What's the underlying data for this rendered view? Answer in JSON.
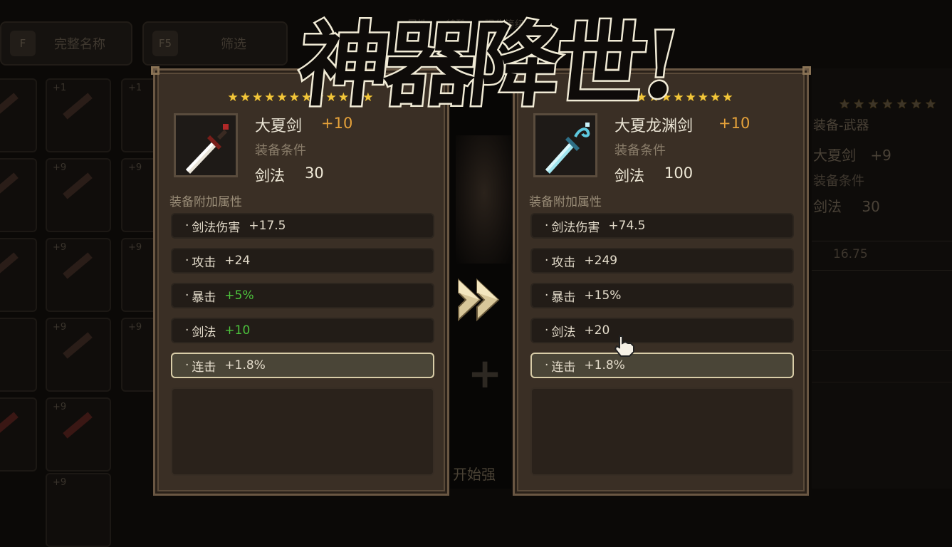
{
  "title_banner": "神器降世!",
  "background": {
    "buttons": [
      {
        "key": "F",
        "label": "完整名称"
      },
      {
        "key": "F5",
        "label": "筛选"
      }
    ],
    "tabs": [
      "属性",
      "特殊",
      "强化等级"
    ],
    "grid_levels": [
      "+1",
      "+1",
      "+9",
      "+9",
      "+9",
      "+9",
      "+9",
      "+9",
      "+9",
      "+9"
    ],
    "side_panel": {
      "stars": "★★★★★★★",
      "category": "装备-武器",
      "item": "大夏剑",
      "item_plus": "+9",
      "req_label": "装备条件",
      "skill": "剑法",
      "skill_value": "30",
      "stat_value": "16.75"
    },
    "start_text": "开始强"
  },
  "left_panel": {
    "stars": "★★★★★★★★★★★★",
    "icon": "sword-icon",
    "name": "大夏剑",
    "plus": "+10",
    "req_label": "装备条件",
    "skill_label": "剑法",
    "skill_value": "30",
    "attr_title": "装备附加属性",
    "attrs": [
      {
        "name": "剑法伤害",
        "value": "+17.5",
        "highlight": false
      },
      {
        "name": "攻击",
        "value": "+24",
        "highlight": false
      },
      {
        "name": "暴击",
        "value": "+5%",
        "highlight": true
      },
      {
        "name": "剑法",
        "value": "+10",
        "highlight": true
      },
      {
        "name": "连击",
        "value": "+1.8%",
        "highlight": false
      }
    ]
  },
  "right_panel": {
    "stars": "★★★★★★★★★★★★",
    "icon": "ice-sword-icon",
    "name": "大夏龙渊剑",
    "plus": "+10",
    "req_label": "装备条件",
    "skill_label": "剑法",
    "skill_value": "100",
    "attr_title": "装备附加属性",
    "attrs": [
      {
        "name": "剑法伤害",
        "value": "+74.5"
      },
      {
        "name": "攻击",
        "value": "+249"
      },
      {
        "name": "暴击",
        "value": "+15%"
      },
      {
        "name": "剑法",
        "value": "+20"
      },
      {
        "name": "连击",
        "value": "+1.8%"
      }
    ]
  },
  "colors": {
    "star": "#f2c63a",
    "plus_level": "#e6a23a",
    "bonus_green": "#4cc23c",
    "panel_bg": "#3a2f25"
  }
}
